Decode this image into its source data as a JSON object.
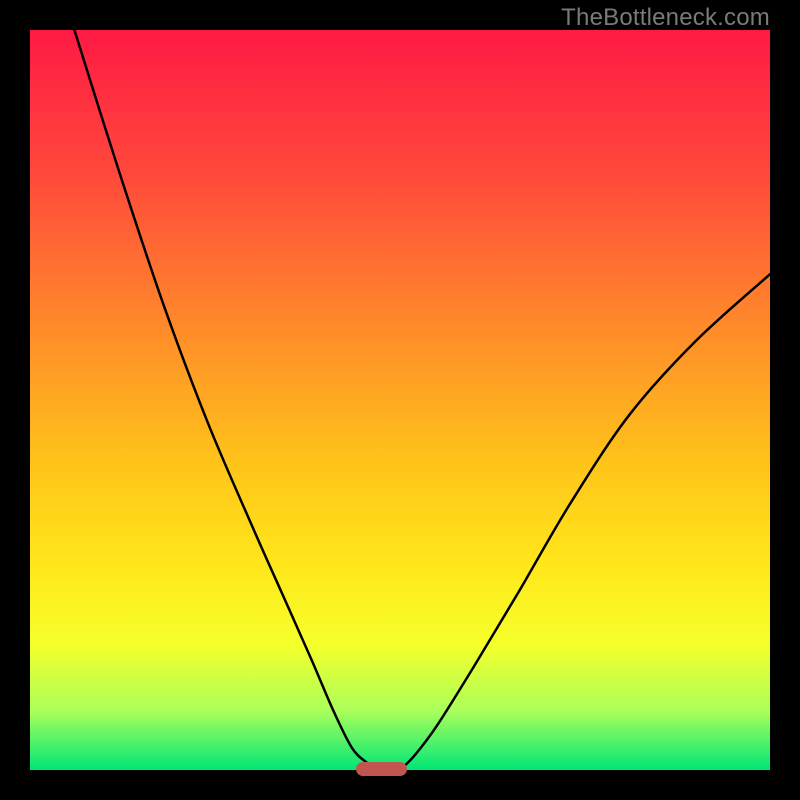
{
  "watermark": "TheBottleneck.com",
  "chart_data": {
    "type": "line",
    "title": "",
    "xlabel": "",
    "ylabel": "",
    "xlim": [
      0,
      100
    ],
    "ylim": [
      0,
      100
    ],
    "grid": false,
    "background_gradient": {
      "top_color": "#ff1a44",
      "bottom_color": "#00e676",
      "description": "vertical red-to-green gradient; green = best match"
    },
    "series": [
      {
        "name": "left-branch",
        "x": [
          6,
          12,
          18,
          24,
          30,
          34,
          38,
          41,
          43.5,
          45.5,
          47
        ],
        "values": [
          100,
          81,
          63,
          47,
          33,
          24,
          15,
          8,
          3,
          1,
          0
        ]
      },
      {
        "name": "right-branch",
        "x": [
          50,
          52,
          55,
          60,
          66,
          73,
          81,
          90,
          100
        ],
        "values": [
          0,
          2,
          6,
          14,
          24,
          36,
          48,
          58,
          67
        ]
      }
    ],
    "annotations": [
      {
        "type": "marker",
        "name": "optimal-range",
        "shape": "rounded-bar",
        "color": "#c1554f",
        "x_range": [
          44,
          51
        ],
        "y": 0
      }
    ]
  }
}
